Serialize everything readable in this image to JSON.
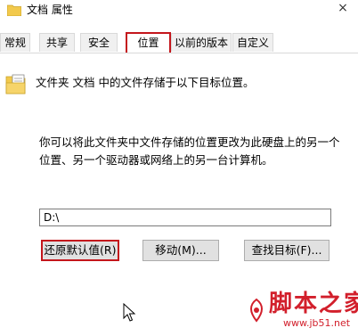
{
  "window": {
    "title": "文档 属性",
    "close_glyph": "×"
  },
  "tabs": [
    {
      "label": "常规"
    },
    {
      "label": "共享"
    },
    {
      "label": "安全"
    },
    {
      "label": "位置",
      "selected": true
    },
    {
      "label": "以前的版本"
    },
    {
      "label": "自定义"
    }
  ],
  "location": {
    "info": "文件夹 文档 中的文件存储于以下目标位置。",
    "description_line1": "你可以将此文件夹中文件存储的位置更改为此硬盘上的另一个",
    "description_line2": "位置、另一个驱动器或网络上的另一台计算机。",
    "path_value": "D:\\"
  },
  "buttons": {
    "restore_default": "还原默认值(R)",
    "move": "移动(M)...",
    "find_target": "查找目标(F)..."
  },
  "icons": {
    "folder": "folder-document-icon",
    "cursor": "mouse-pointer-icon"
  },
  "watermark": {
    "brand": "脚本之家",
    "url": "www.jb51.net"
  },
  "colors": {
    "highlight": "#c4161c",
    "button_bg": "#e1e1e1",
    "folder_yellow": "#f2c94c"
  }
}
